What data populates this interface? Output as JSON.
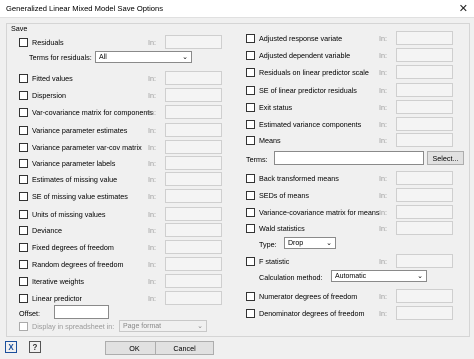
{
  "window": {
    "title": "Generalized Linear Mixed Model Save Options",
    "close_glyph": "✕"
  },
  "group_label": "Save",
  "in_label": "In:",
  "left": {
    "residuals": "Residuals",
    "terms_for_residuals_label": "Terms for residuals:",
    "terms_for_residuals_value": "All",
    "checkboxes": [
      "Fitted values",
      "Dispersion",
      "Var-covariance matrix for components",
      "Variance parameter estimates",
      "Variance parameter var-cov matrix",
      "Variance parameter labels",
      "Estimates of missing value",
      "SE of missing value estimates",
      "Units of missing values",
      "Deviance",
      "Fixed degrees of freedom",
      "Random degrees of freedom",
      "Iterative weights",
      "Linear predictor"
    ],
    "offset_label": "Offset:",
    "display_in_spreadsheet": "Display in spreadsheet in:",
    "page_format": "Page format"
  },
  "right": {
    "top_checkboxes": [
      "Adjusted response variate",
      "Adjusted dependent variable",
      "Residuals on linear predictor scale",
      "SE of linear predictor residuals",
      "Exit status",
      "Estimated variance components",
      "Means"
    ],
    "terms_label": "Terms:",
    "select_button": "Select...",
    "mid_checkboxes": [
      "Back transformed means",
      "SEDs of means",
      "Variance-covariance matrix for means",
      "Wald statistics"
    ],
    "type_label": "Type:",
    "type_value": "Drop",
    "f_statistic": "F statistic",
    "calc_method_label": "Calculation method:",
    "calc_method_value": "Automatic",
    "bottom_checkboxes": [
      "Numerator degrees of freedom",
      "Denominator degrees of freedom"
    ]
  },
  "footer": {
    "ok": "OK",
    "cancel": "Cancel",
    "help_glyph": "?",
    "clear_glyph": "X"
  }
}
